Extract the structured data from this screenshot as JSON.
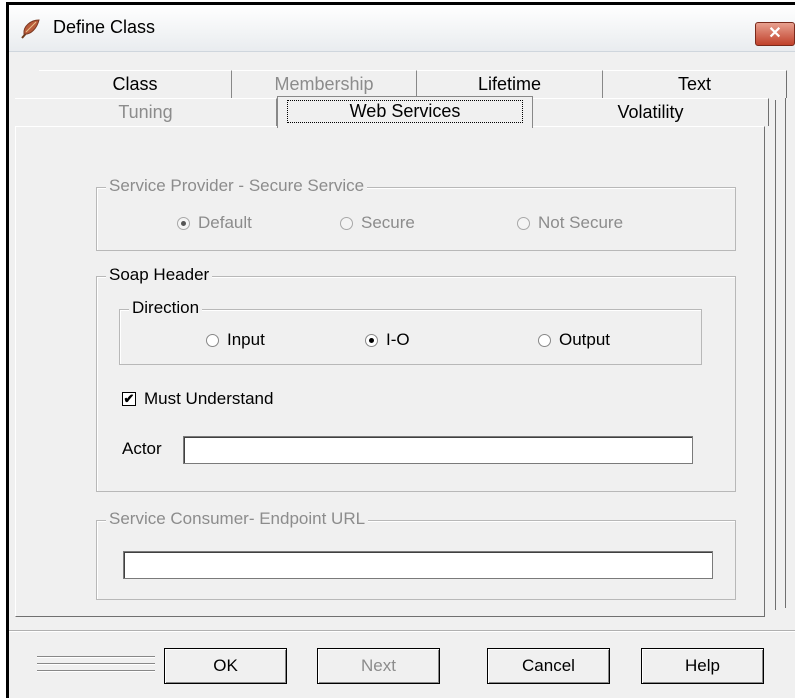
{
  "window": {
    "title": "Define Class",
    "close_glyph": "✕",
    "icon": "feather-app-icon"
  },
  "tabs_row1": [
    {
      "label": "Class",
      "enabled": true
    },
    {
      "label": "Membership",
      "enabled": false
    },
    {
      "label": "Lifetime",
      "enabled": true
    },
    {
      "label": "Text",
      "enabled": true
    }
  ],
  "tabs_row2": [
    {
      "label": "Tuning",
      "enabled": false
    },
    {
      "label": "Web Services",
      "enabled": true,
      "selected": true
    },
    {
      "label": "Volatility",
      "enabled": true
    }
  ],
  "provider": {
    "legend": "Service Provider - Secure Service",
    "options": [
      {
        "label": "Default",
        "selected": true
      },
      {
        "label": "Secure",
        "selected": false
      },
      {
        "label": "Not Secure",
        "selected": false
      }
    ]
  },
  "soap": {
    "legend": "Soap Header",
    "direction_legend": "Direction",
    "direction_options": [
      {
        "label": "Input",
        "selected": false
      },
      {
        "label": "I-O",
        "selected": true
      },
      {
        "label": "Output",
        "selected": false
      }
    ],
    "must_understand_label": "Must Understand",
    "must_understand_checked": true,
    "check_glyph": "✔",
    "actor_label": "Actor",
    "actor_value": ""
  },
  "consumer": {
    "legend": "Service Consumer- Endpoint URL",
    "url_value": ""
  },
  "buttons": {
    "ok": "OK",
    "next": "Next",
    "cancel": "Cancel",
    "help": "Help"
  }
}
